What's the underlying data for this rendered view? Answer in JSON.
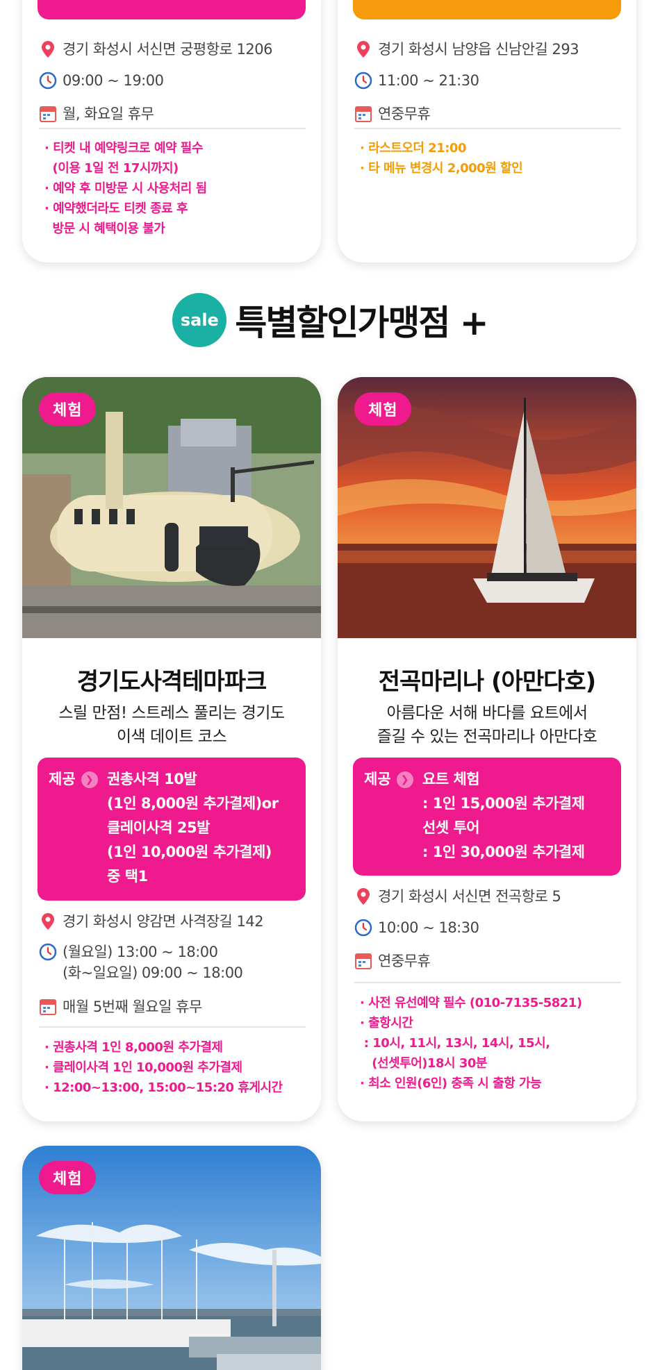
{
  "top_cards": [
    {
      "address": "경기 화성시 서신면 궁평항로 1206",
      "hours": "09:00 ~ 19:00",
      "closed": "월, 화요일 휴무",
      "notes": [
        "· 티켓 내 예약링크로 예약 필수",
        "  (이용 1일 전 17시까지)",
        "· 예약 후 미방문 시 사용처리 됨",
        "· 예약했더라도 티켓 종료 후",
        "  방문 시 혜택이용 불가"
      ],
      "button_color": "#ee1a8e",
      "note_color": "#ee1a8e"
    },
    {
      "address": "경기 화성시 남양읍 신남안길 293",
      "hours": "11:00 ~ 21:30",
      "closed": "연중무휴",
      "notes": [
        "· 라스트오더 21:00",
        "· 타 메뉴 변경시 2,000원 할인"
      ],
      "button_color": "#f79a0b",
      "note_color": "#f59c00"
    }
  ],
  "section": {
    "badge": "sale",
    "title": "특별할인가맹점 +"
  },
  "cards": [
    {
      "tag": "체험",
      "photo_icon": "helicopter-photo",
      "title": "경기도사격테마파크",
      "desc1": "스릴 만점! 스트레스 풀리는 경기도",
      "desc2": "이색 데이트 코스",
      "offer_label": "제공",
      "offer_lines": [
        "권총사격 10발",
        "(1인 8,000원 추가결제)or",
        "클레이사격 25발",
        "(1인 10,000원 추가결제)",
        "중 택1"
      ],
      "address": "경기 화성시 양감면 사격장길 142",
      "hours1": "(월요일) 13:00 ~ 18:00",
      "hours2": "(화~일요일) 09:00 ~ 18:00",
      "closed": "매월 5번째 월요일 휴무",
      "notes": [
        "· 권총사격 1인 8,000원 추가결제",
        "· 클레이사격 1인 10,000원 추가결제",
        "· 12:00~13:00, 15:00~15:20 휴게시간"
      ]
    },
    {
      "tag": "체험",
      "photo_icon": "sailboat-sunset-photo",
      "title": "전곡마리나 (아만다호)",
      "desc1": "아름다운 서해 바다를 요트에서",
      "desc2": "즐길 수 있는 전곡마리나 아만다호",
      "offer_label": "제공",
      "offer_lines": [
        "요트 체험",
        ": 1인 15,000원 추가결제",
        "선셋 투어",
        ": 1인 30,000원 추가결제"
      ],
      "address": "경기 화성시 서신면 전곡항로 5",
      "hours": "10:00 ~ 18:30",
      "closed": "연중무휴",
      "notes": [
        "· 사전 유선예약 필수 (010-7135-5821)",
        "· 출항시간",
        " : 10시, 11시, 13시, 14시, 15시,",
        "   (선셋투어)18시 30분",
        "· 최소 인원(6인) 충족 시 출항 가능"
      ]
    },
    {
      "tag": "체험",
      "photo_icon": "marina-photo"
    }
  ]
}
